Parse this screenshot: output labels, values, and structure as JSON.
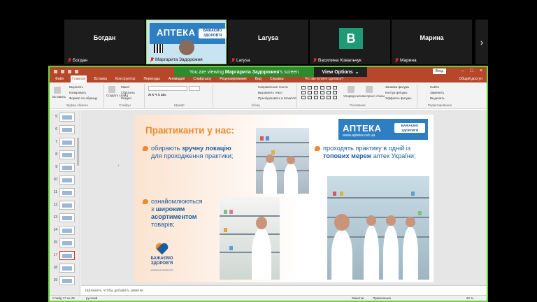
{
  "participants": [
    {
      "name": "Богдан",
      "label": "Богдан",
      "muted": true
    },
    {
      "name": "Маргарита Задорожня",
      "label": "Маргарита Задорожня",
      "muted": true,
      "active": true
    },
    {
      "name": "Larysa",
      "label": "Larysa",
      "muted": true
    },
    {
      "name": "Василина Ковальчук",
      "label": "Василина Ковальчук",
      "muted": true,
      "avatar_letter": "B",
      "avatar_color": "#1e9b74"
    },
    {
      "name": "Марина",
      "label": "Марина",
      "muted": true
    }
  ],
  "active_tile": {
    "banner_text": "АПТЕКА",
    "badge_text": "БАЖАЄМО ЗДОРОВ'Я"
  },
  "nav_next_icon": "chevron-right-icon",
  "zoom": {
    "viewing_prefix": "You are viewing",
    "viewing_name": "Маргарита Задорожня",
    "viewing_suffix": "'s screen",
    "view_options": "View Options"
  },
  "ppt": {
    "sign_in": "Вход",
    "tabs": [
      "Файл",
      "Главная",
      "Вставка",
      "Конструктор",
      "Переходы",
      "Анимация",
      "Слайд-шоу",
      "Рецензирование",
      "Вид",
      "Справка"
    ],
    "selected_tab": "Главная",
    "tell_me": "Что вы хотите сделать?",
    "share": "Общий доступ",
    "ribbon": {
      "paste": "Вставить",
      "cut": "Вырезать",
      "copy": "Копировать",
      "format_painter": "Формат по образцу",
      "clipboard": "Буфер обмена",
      "new_slide": "Создать слайд",
      "layout": "Макет",
      "reset": "Сбросить",
      "section": "Раздел",
      "slides": "Слайды",
      "font": "Шрифт",
      "paragraph": "Абзац",
      "direction": "Направление текста",
      "align_text": "Выровнять текст",
      "smartart": "Преобразовать в SmartArt",
      "arrange": "Упорядочить",
      "express_styles": "Экспресс-стили",
      "drawing": "Рисование",
      "fill": "Заливка фигуры",
      "outline": "Контур фигуры",
      "effects": "Эффекты фигуры",
      "find": "Найти",
      "replace": "Заменить",
      "select": "Выделить",
      "editing": "Редактирование"
    },
    "thumb_numbers": [
      "5",
      "6",
      "7",
      "8",
      "9",
      "10",
      "11",
      "12",
      "13",
      "14",
      "15",
      "16",
      "17",
      "18",
      "19"
    ],
    "selected_slide": "17",
    "notes": "Щёлкните, чтобы добавить заметки",
    "status": {
      "slide_info": "Слайд 17 из 25",
      "lang": "русский",
      "notes_btn": "Заметки",
      "comments_btn": "Примечания",
      "zoom_level": "62 %"
    }
  },
  "slide": {
    "title": "Практиканти у нас:",
    "bullet1_a": "обирають ",
    "bullet1_b": "зручну локацію",
    "bullet1_c": "для проходження практики;",
    "bullet2_a": "ознайомлюються",
    "bullet2_b": "з ",
    "bullet2_c": "широким асортиментом",
    "bullet2_d": "товарів;",
    "bullet3_a": "проходять практику в одній із",
    "bullet3_b": "топових мереж",
    "bullet3_c": " аптек України;",
    "logo_text": "АПТЕКА",
    "logo_badge": "БАЖАЄМО ЗДОРОВ'Я",
    "logo_url": "www.apteka.net.ua",
    "small_logo_1": "БАЖАЄМО",
    "small_logo_2": "ЗДОРОВ'Я",
    "small_logo_3": "національна мережа аптек"
  }
}
